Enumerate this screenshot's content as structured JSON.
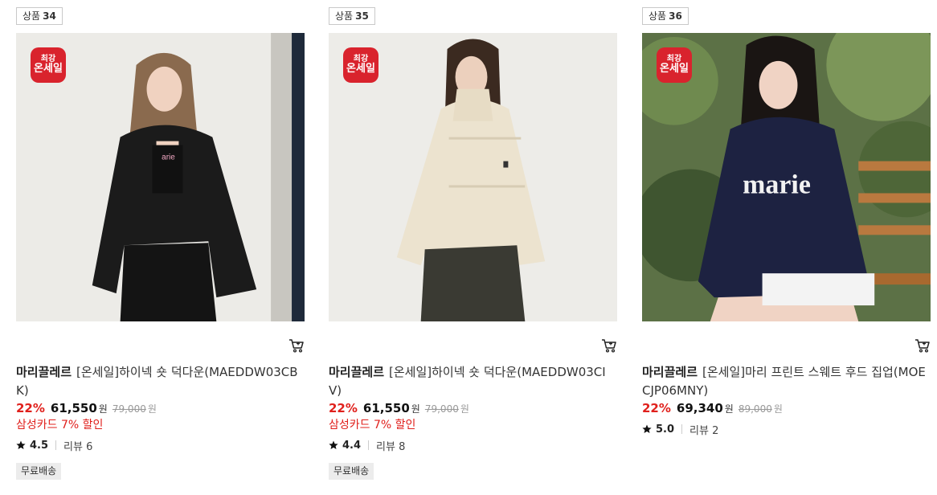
{
  "products": [
    {
      "tag_label": "상품",
      "tag_no": "34",
      "badge_line1": "최강",
      "badge_line2": "온세일",
      "brand": "마리끌레르",
      "name": "[온세일]하이넥 숏 덕다운(MAEDDW03CBK)",
      "discount": "22%",
      "price": "61,550",
      "currency": "원",
      "original_price": "79,000",
      "card_promo": "삼성카드 7% 할인",
      "rating": "4.5",
      "review": "리뷰 6",
      "shipping": "무료배송"
    },
    {
      "tag_label": "상품",
      "tag_no": "35",
      "badge_line1": "최강",
      "badge_line2": "온세일",
      "brand": "마리끌레르",
      "name": "[온세일]하이넥 숏 덕다운(MAEDDW03CIV)",
      "discount": "22%",
      "price": "61,550",
      "currency": "원",
      "original_price": "79,000",
      "card_promo": "삼성카드 7% 할인",
      "rating": "4.4",
      "review": "리뷰 8",
      "shipping": "무료배송"
    },
    {
      "tag_label": "상품",
      "tag_no": "36",
      "badge_line1": "최강",
      "badge_line2": "온세일",
      "brand": "마리끌레르",
      "name": "[온세일]마리 프린트 스웨트 후드 집업(MOECJP06MNY)",
      "discount": "22%",
      "price": "69,340",
      "currency": "원",
      "original_price": "89,000",
      "rating": "5.0",
      "review": "리뷰 2"
    }
  ],
  "colors": {
    "discount": "#e0201c",
    "badge": "#d9232d"
  },
  "icons": {
    "cart": "cart-icon",
    "star": "star-icon"
  }
}
